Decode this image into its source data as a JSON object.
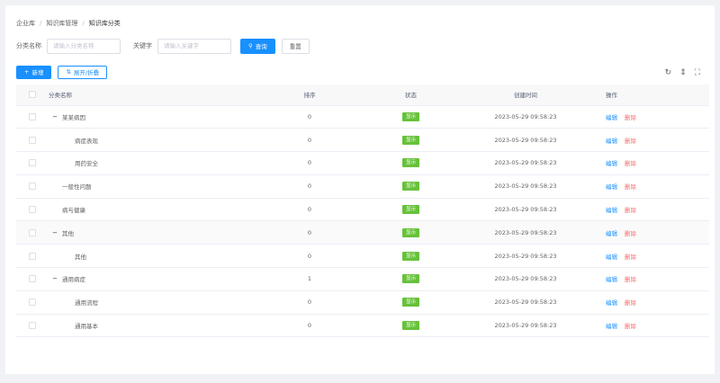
{
  "breadcrumb": [
    "企业库",
    "知识库管理",
    "知识库分类"
  ],
  "search": {
    "name_label": "分类名称",
    "name_placeholder": "请输入分类名称",
    "keyword_label": "关键字",
    "keyword_placeholder": "请输入关键字",
    "query_label": "查询",
    "reset_label": "重置"
  },
  "toolbar": {
    "add_label": "新增",
    "expand_label": "展开/折叠"
  },
  "table": {
    "headers": {
      "name": "分类名称",
      "sort": "排序",
      "status": "状态",
      "time": "创建时间",
      "ops": "操作"
    },
    "edit_label": "编辑",
    "delete_label": "删除",
    "rows": [
      {
        "name": "某某病因",
        "expand": "−",
        "indent": 0,
        "sort": "0",
        "status": "显示",
        "time": "2023-05-29 09:58:23"
      },
      {
        "name": "病症表现",
        "expand": "",
        "indent": 1,
        "sort": "0",
        "status": "显示",
        "time": "2023-05-29 09:58:23"
      },
      {
        "name": "用药安全",
        "expand": "",
        "indent": 1,
        "sort": "0",
        "status": "显示",
        "time": "2023-05-29 09:58:23"
      },
      {
        "name": "一般性问题",
        "expand": "",
        "indent": 0,
        "sort": "0",
        "status": "显示",
        "time": "2023-05-29 09:58:23"
      },
      {
        "name": "病与健康",
        "expand": "",
        "indent": 0,
        "sort": "0",
        "status": "显示",
        "time": "2023-05-29 09:58:23"
      },
      {
        "name": "其他",
        "expand": "−",
        "indent": 0,
        "sort": "0",
        "status": "显示",
        "time": "2023-05-29 09:58:23"
      },
      {
        "name": "其他",
        "expand": "",
        "indent": 1,
        "sort": "0",
        "status": "显示",
        "time": "2023-05-29 09:58:23"
      },
      {
        "name": "通用病症",
        "expand": "−",
        "indent": 0,
        "sort": "1",
        "status": "显示",
        "time": "2023-05-29 09:58:23"
      },
      {
        "name": "通用流程",
        "expand": "",
        "indent": 1,
        "sort": "0",
        "status": "显示",
        "time": "2023-05-29 09:58:23"
      },
      {
        "name": "通用基本",
        "expand": "",
        "indent": 1,
        "sort": "0",
        "status": "显示",
        "time": "2023-05-29 09:58:23"
      }
    ]
  },
  "right_tools": [
    "refresh-icon",
    "column-height-icon",
    "fullscreen-icon"
  ]
}
